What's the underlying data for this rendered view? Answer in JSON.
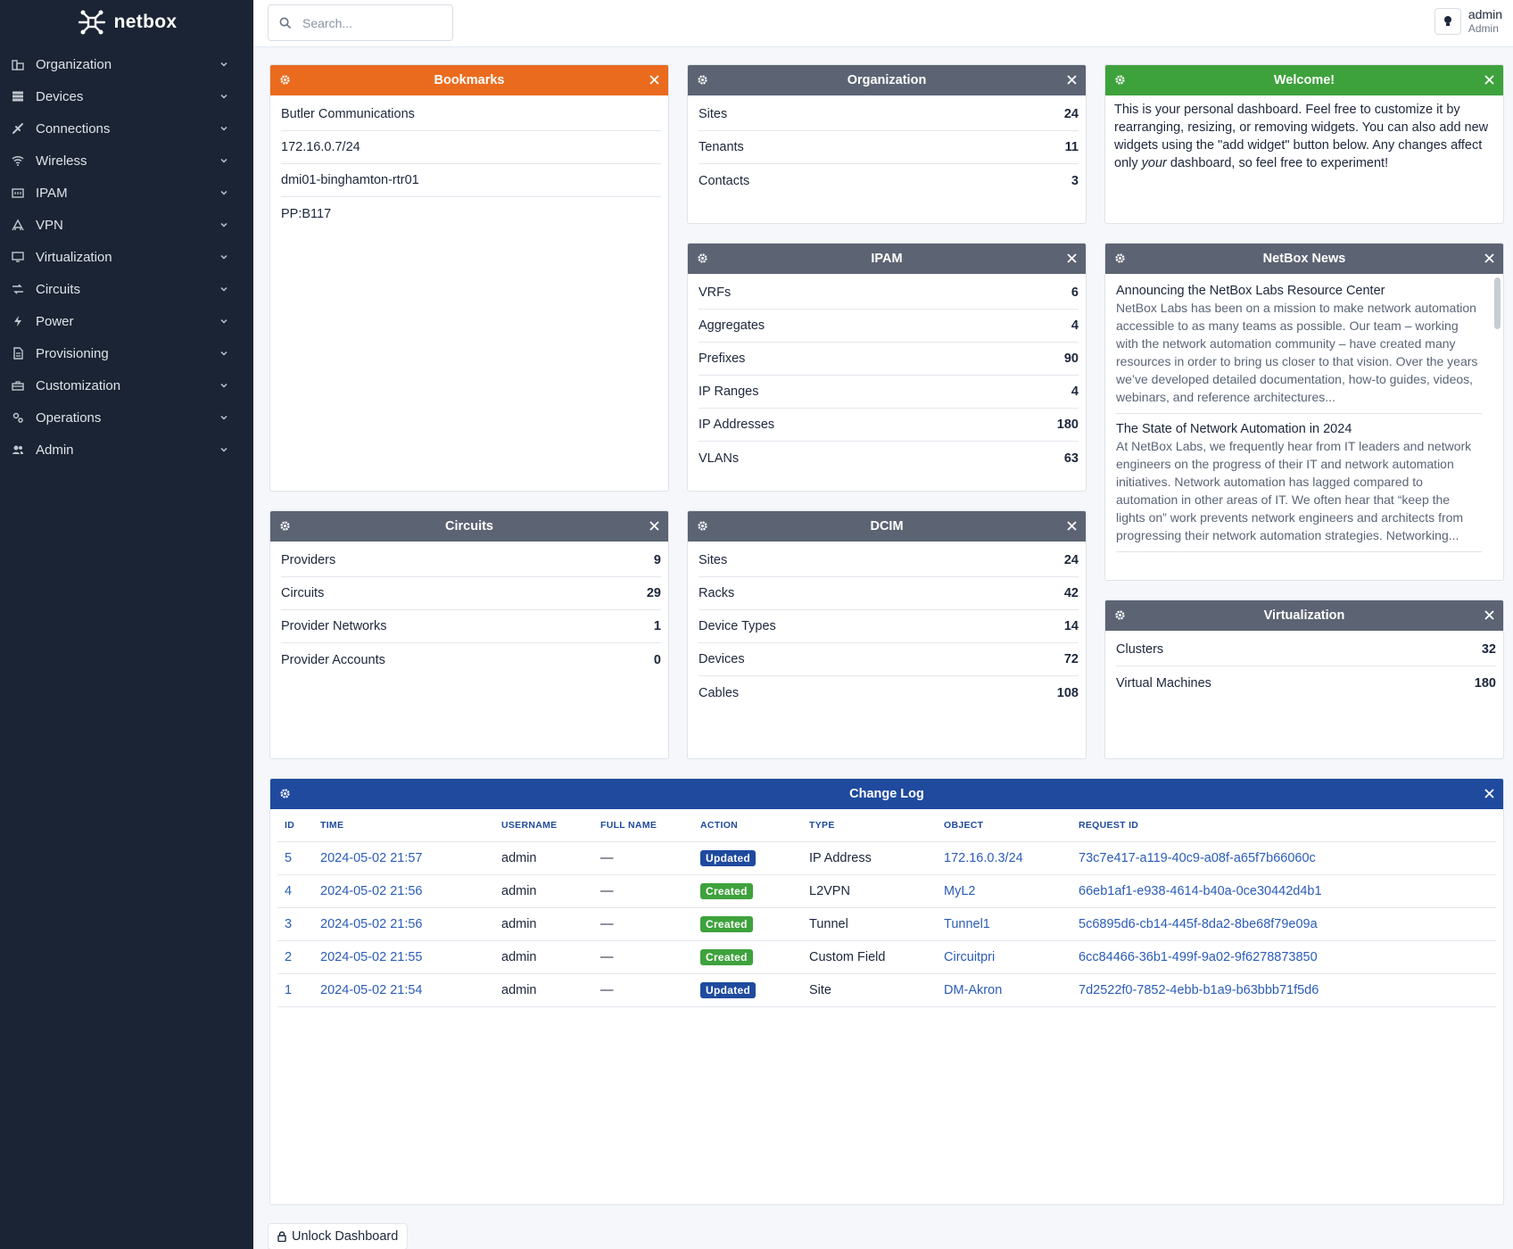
{
  "brand": {
    "name": "netbox"
  },
  "search": {
    "placeholder": "Search..."
  },
  "user": {
    "name": "admin",
    "role": "Admin"
  },
  "sidebar": {
    "items": [
      {
        "label": "Organization",
        "icon": "domain-icon"
      },
      {
        "label": "Devices",
        "icon": "server-icon"
      },
      {
        "label": "Connections",
        "icon": "connection-icon"
      },
      {
        "label": "Wireless",
        "icon": "wifi-icon"
      },
      {
        "label": "IPAM",
        "icon": "counter-icon"
      },
      {
        "label": "VPN",
        "icon": "tunnel-icon"
      },
      {
        "label": "Virtualization",
        "icon": "monitor-icon"
      },
      {
        "label": "Circuits",
        "icon": "transit-icon"
      },
      {
        "label": "Power",
        "icon": "flash-icon"
      },
      {
        "label": "Provisioning",
        "icon": "file-document-icon"
      },
      {
        "label": "Customization",
        "icon": "toolbox-icon"
      },
      {
        "label": "Operations",
        "icon": "cogs-icon"
      },
      {
        "label": "Admin",
        "icon": "account-multiple-icon"
      }
    ]
  },
  "widgets": {
    "bookmarks": {
      "title": "Bookmarks",
      "items": [
        "Butler Communications",
        "172.16.0.7/24",
        "dmi01-binghamton-rtr01",
        "PP:B117"
      ]
    },
    "organization": {
      "title": "Organization",
      "rows": [
        {
          "label": "Sites",
          "count": "24"
        },
        {
          "label": "Tenants",
          "count": "11"
        },
        {
          "label": "Contacts",
          "count": "3"
        }
      ]
    },
    "welcome": {
      "title": "Welcome!",
      "text_before": "This is your personal dashboard. Feel free to customize it by rearranging, resizing, or removing widgets. You can also add new widgets using the \"add widget\" button below. Any changes affect only ",
      "text_em": "your",
      "text_after": " dashboard, so feel free to experiment!"
    },
    "ipam": {
      "title": "IPAM",
      "rows": [
        {
          "label": "VRFs",
          "count": "6"
        },
        {
          "label": "Aggregates",
          "count": "4"
        },
        {
          "label": "Prefixes",
          "count": "90"
        },
        {
          "label": "IP Ranges",
          "count": "4"
        },
        {
          "label": "IP Addresses",
          "count": "180"
        },
        {
          "label": "VLANs",
          "count": "63"
        }
      ]
    },
    "news": {
      "title": "NetBox News",
      "items": [
        {
          "title": "Announcing the NetBox Labs Resource Center",
          "body": "NetBox Labs has been on a mission to make network automation accessible to as many teams as possible. Our team – working with the network automation community – have created many resources in order to bring us closer to that vision. Over the years we’ve developed detailed documentation, how-to guides, videos, webinars, and reference architectures..."
        },
        {
          "title": "The State of Network Automation in 2024",
          "body": "At NetBox Labs, we frequently hear from IT leaders and network engineers on the progress of their IT and network automation initiatives. Network automation has lagged compared to automation in other areas of IT. We often hear that “keep the lights on” work prevents network engineers and architects from progressing their network automation strategies. Networking..."
        }
      ]
    },
    "circuits": {
      "title": "Circuits",
      "rows": [
        {
          "label": "Providers",
          "count": "9"
        },
        {
          "label": "Circuits",
          "count": "29"
        },
        {
          "label": "Provider Networks",
          "count": "1"
        },
        {
          "label": "Provider Accounts",
          "count": "0"
        }
      ]
    },
    "dcim": {
      "title": "DCIM",
      "rows": [
        {
          "label": "Sites",
          "count": "24"
        },
        {
          "label": "Racks",
          "count": "42"
        },
        {
          "label": "Device Types",
          "count": "14"
        },
        {
          "label": "Devices",
          "count": "72"
        },
        {
          "label": "Cables",
          "count": "108"
        }
      ]
    },
    "virtualization": {
      "title": "Virtualization",
      "rows": [
        {
          "label": "Clusters",
          "count": "32"
        },
        {
          "label": "Virtual Machines",
          "count": "180"
        }
      ]
    },
    "changelog": {
      "title": "Change Log",
      "columns": [
        "ID",
        "TIME",
        "USERNAME",
        "FULL NAME",
        "ACTION",
        "TYPE",
        "OBJECT",
        "REQUEST ID"
      ],
      "rows": [
        {
          "id": "5",
          "time": "2024-05-02 21:57",
          "username": "admin",
          "full_name": "—",
          "action": "Updated",
          "type": "IP Address",
          "object": "172.16.0.3/24",
          "request_id": "73c7e417-a119-40c9-a08f-a65f7b66060c"
        },
        {
          "id": "4",
          "time": "2024-05-02 21:56",
          "username": "admin",
          "full_name": "—",
          "action": "Created",
          "type": "L2VPN",
          "object": "MyL2",
          "request_id": "66eb1af1-e938-4614-b40a-0ce30442d4b1"
        },
        {
          "id": "3",
          "time": "2024-05-02 21:56",
          "username": "admin",
          "full_name": "—",
          "action": "Created",
          "type": "Tunnel",
          "object": "Tunnel1",
          "request_id": "5c6895d6-cb14-445f-8da2-8be68f79e09a"
        },
        {
          "id": "2",
          "time": "2024-05-02 21:55",
          "username": "admin",
          "full_name": "—",
          "action": "Created",
          "type": "Custom Field",
          "object": "Circuitpri",
          "request_id": "6cc84466-36b1-499f-9a02-9f6278873850"
        },
        {
          "id": "1",
          "time": "2024-05-02 21:54",
          "username": "admin",
          "full_name": "—",
          "action": "Updated",
          "type": "Site",
          "object": "DM-Akron",
          "request_id": "7d2522f0-7852-4ebb-b1a9-b63bbb71f5d6"
        }
      ]
    }
  },
  "footer": {
    "unlock_label": "Unlock Dashboard"
  },
  "colors": {
    "sidebar_bg": "#1b2434",
    "bookmarks_header": "#ea6b1e",
    "widget_header": "#5c6373",
    "welcome_header": "#3ea23c",
    "changelog_header": "#1f4a9e",
    "badge_updated": "#1f4a9e",
    "badge_created": "#3ea23c",
    "link": "#2b5cb8"
  }
}
